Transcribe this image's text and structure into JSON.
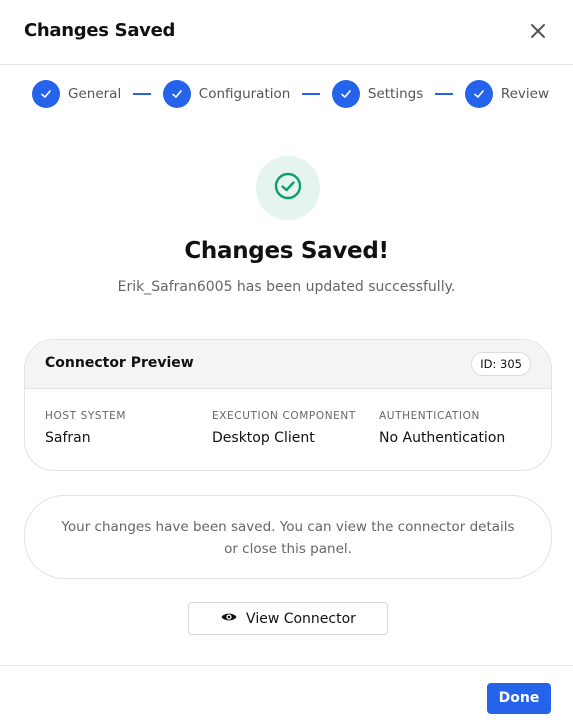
{
  "dialog": {
    "title": "Changes Saved"
  },
  "stepper": {
    "steps": [
      {
        "label": "General",
        "status": "complete"
      },
      {
        "label": "Configuration",
        "status": "complete"
      },
      {
        "label": "Settings",
        "status": "complete"
      },
      {
        "label": "Review",
        "status": "complete"
      }
    ],
    "accent_color": "#2563eb"
  },
  "success": {
    "icon": "check-circle-icon",
    "icon_color": "#0f9d6b",
    "headline": "Changes Saved!",
    "message": "Erik_Safran6005 has been updated successfully."
  },
  "preview": {
    "title": "Connector Preview",
    "id_label": "ID: 305",
    "fields": [
      {
        "label": "HOST SYSTEM",
        "value": "Safran"
      },
      {
        "label": "EXECUTION COMPONENT",
        "value": "Desktop Client"
      },
      {
        "label": "AUTHENTICATION",
        "value": "No Authentication"
      }
    ]
  },
  "notice": {
    "text": "Your changes have been saved. You can view the connector details or close this panel."
  },
  "actions": {
    "view_label": "View Connector",
    "view_icon": "eye-icon",
    "done_label": "Done"
  }
}
